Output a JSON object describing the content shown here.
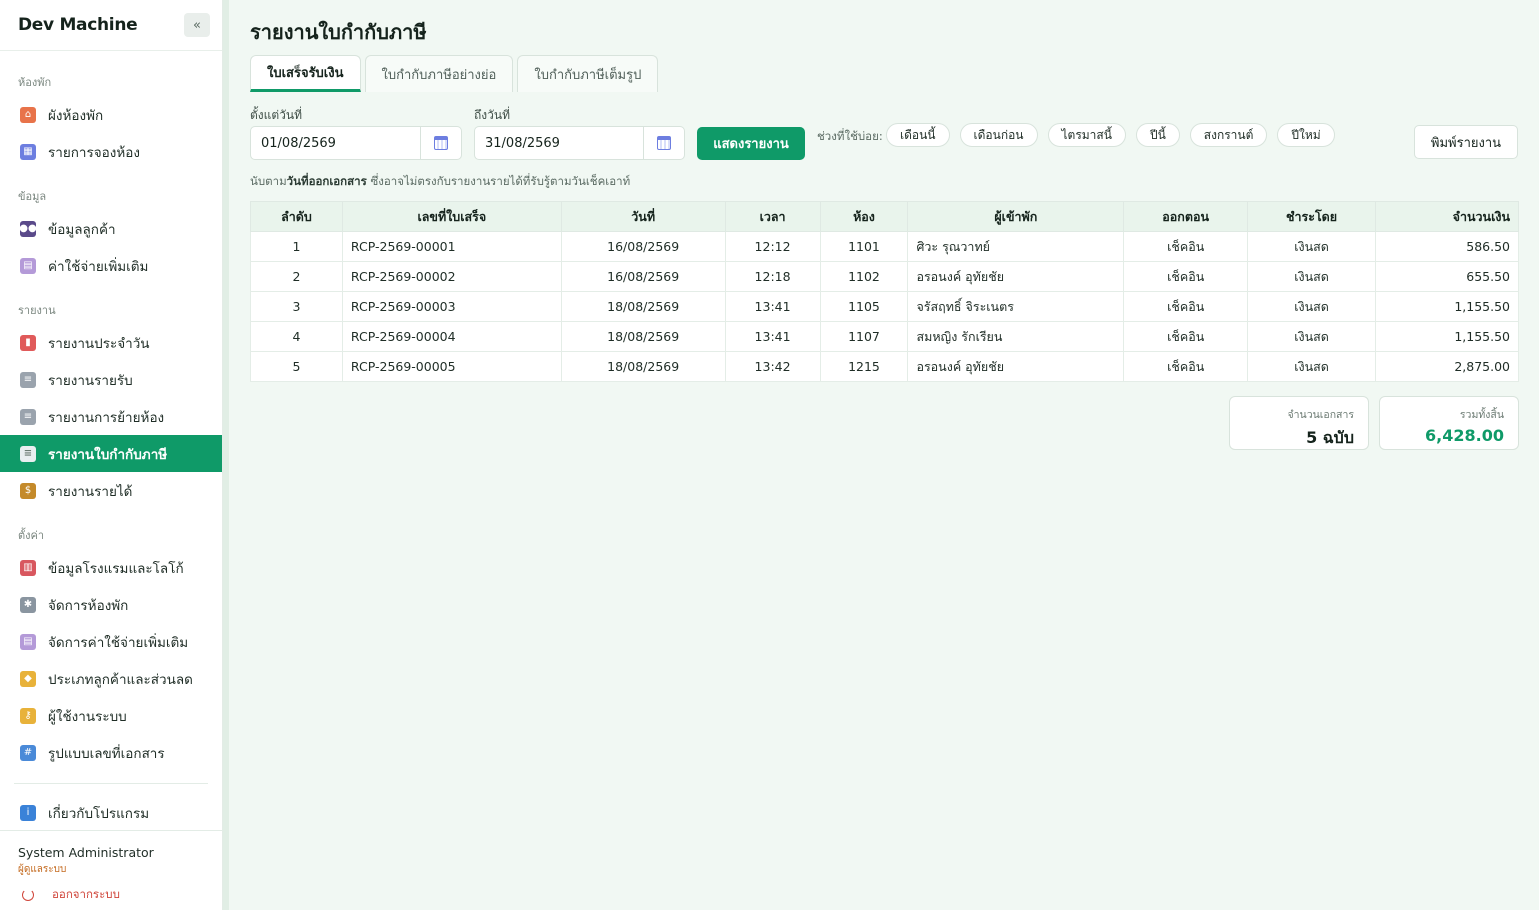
{
  "app": {
    "title": "Dev Machine",
    "collapse_icon": "«"
  },
  "sidebar": {
    "sections": [
      {
        "label": "ห้องพัก",
        "items": [
          {
            "label": "ผังห้องพัก",
            "icon": "house-icon",
            "color": "#e8734a"
          },
          {
            "label": "รายการจองห้อง",
            "icon": "calendar-icon",
            "color": "#6d7ee0"
          }
        ]
      },
      {
        "label": "ข้อมูล",
        "items": [
          {
            "label": "ข้อมูลลูกค้า",
            "icon": "people-icon",
            "color": "#5a4a8a"
          },
          {
            "label": "ค่าใช้จ่ายเพิ่มเติม",
            "icon": "receipt-icon",
            "color": "#b49ad8"
          }
        ]
      },
      {
        "label": "รายงาน",
        "items": [
          {
            "label": "รายงานประจำวัน",
            "icon": "bar-chart-icon",
            "color": "#e05a5a"
          },
          {
            "label": "รายงานรายรับ",
            "icon": "document-icon",
            "color": "#9aa3ad"
          },
          {
            "label": "รายงานการย้ายห้อง",
            "icon": "document-icon",
            "color": "#9aa3ad"
          },
          {
            "label": "รายงานใบกำกับภาษี",
            "icon": "document-icon",
            "color": "#9aa3ad",
            "active": true
          },
          {
            "label": "รายงานรายได้",
            "icon": "money-bag-icon",
            "color": "#c48a2a"
          }
        ]
      },
      {
        "label": "ตั้งค่า",
        "items": [
          {
            "label": "ข้อมูลโรงแรมและโลโก้",
            "icon": "hotel-icon",
            "color": "#d8575f"
          },
          {
            "label": "จัดการห้องพัก",
            "icon": "gear-icon",
            "color": "#8a95a0"
          },
          {
            "label": "จัดการค่าใช้จ่ายเพิ่มเติม",
            "icon": "receipt-icon",
            "color": "#b49ad8"
          },
          {
            "label": "ประเภทลูกค้าและส่วนลด",
            "icon": "tag-icon",
            "color": "#e8b23a"
          },
          {
            "label": "ผู้ใช้งานระบบ",
            "icon": "key-icon",
            "color": "#e8b23a"
          },
          {
            "label": "รูปแบบเลขที่เอกสาร",
            "icon": "numbers-icon",
            "color": "#4a8ad8"
          }
        ]
      }
    ],
    "about": {
      "label": "เกี่ยวกับโปรแกรม",
      "icon": "info-icon",
      "color": "#3a82d8"
    },
    "user": {
      "name": "System Administrator",
      "role": "ผู้ดูแลระบบ",
      "logout": "ออกจากระบบ"
    }
  },
  "page": {
    "title": "รายงานใบกำกับภาษี",
    "tabs": [
      {
        "label": "ใบเสร็จรับเงิน",
        "active": true
      },
      {
        "label": "ใบกำกับภาษีอย่างย่อ"
      },
      {
        "label": "ใบกำกับภาษีเต็มรูป"
      }
    ],
    "filters": {
      "from_label": "ตั้งแต่วันที่",
      "from_value": "01/08/2569",
      "to_label": "ถึงวันที่",
      "to_value": "31/08/2569",
      "show_button": "แสดงรายงาน",
      "quick_label": "ช่วงที่ใช้บ่อย:",
      "quick_ranges": [
        "เดือนนี้",
        "เดือนก่อน",
        "ไตรมาสนี้",
        "ปีนี้",
        "สงกรานต์",
        "ปีใหม่"
      ],
      "print_button": "พิมพ์รายงาน"
    },
    "note": {
      "prefix": "นับตาม",
      "bold": "วันที่ออกเอกสาร",
      "suffix": " ซึ่งอาจไม่ตรงกับรายงานรายได้ที่รับรู้ตามวันเช็คเอาท์"
    },
    "table": {
      "headers": [
        "ลำดับ",
        "เลขที่ใบเสร็จ",
        "วันที่",
        "เวลา",
        "ห้อง",
        "ผู้เข้าพัก",
        "ออกตอน",
        "ชำระโดย",
        "จำนวนเงิน"
      ],
      "rows": [
        [
          "1",
          "RCP-2569-00001",
          "16/08/2569",
          "12:12",
          "1101",
          "ศิวะ รุณวาทย์",
          "เช็คอิน",
          "เงินสด",
          "586.50"
        ],
        [
          "2",
          "RCP-2569-00002",
          "16/08/2569",
          "12:18",
          "1102",
          "อรอนงค์ อุทัยชัย",
          "เช็คอิน",
          "เงินสด",
          "655.50"
        ],
        [
          "3",
          "RCP-2569-00003",
          "18/08/2569",
          "13:41",
          "1105",
          "จรัสฤทธิ์ จิระเนตร",
          "เช็คอิน",
          "เงินสด",
          "1,155.50"
        ],
        [
          "4",
          "RCP-2569-00004",
          "18/08/2569",
          "13:41",
          "1107",
          "สมหญิง รักเรียน",
          "เช็คอิน",
          "เงินสด",
          "1,155.50"
        ],
        [
          "5",
          "RCP-2569-00005",
          "18/08/2569",
          "13:42",
          "1215",
          "อรอนงค์ อุทัยชัย",
          "เช็คอิน",
          "เงินสด",
          "2,875.00"
        ]
      ]
    },
    "summary": {
      "doc_count_label": "จำนวนเอกสาร",
      "doc_count_value": "5 ฉบับ",
      "total_label": "รวมทั้งสิ้น",
      "total_value": "6,428.00"
    }
  },
  "colors": {
    "accent": "#0f9a68",
    "background": "#f1f8f3"
  }
}
